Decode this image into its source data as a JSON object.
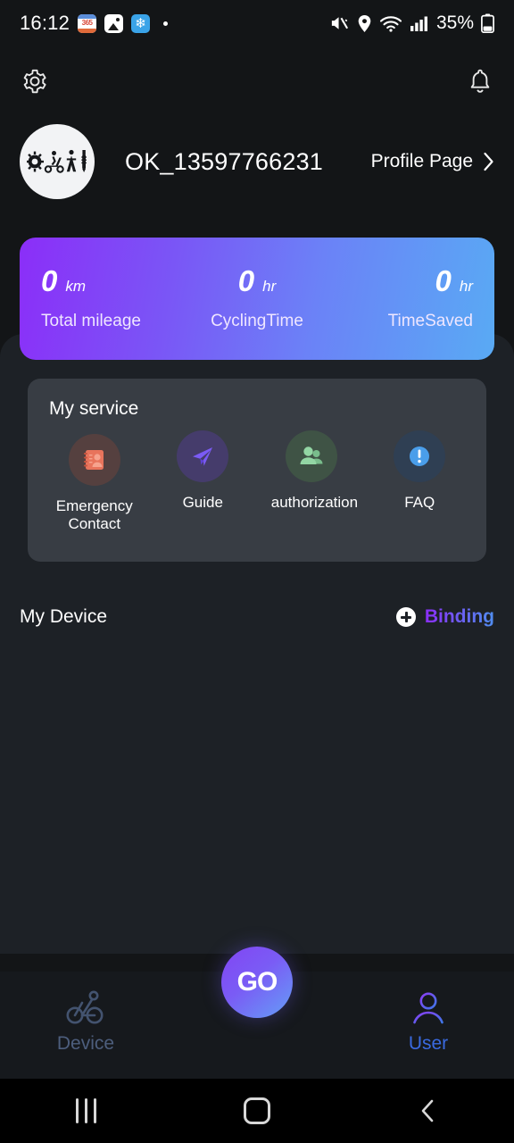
{
  "status_bar": {
    "time": "16:12",
    "app_icons": [
      "calendar-365-icon",
      "photos-icon",
      "snowflake-icon",
      "dot-indicator"
    ],
    "calendar_badge": "365",
    "battery_text": "35%",
    "right_icons": [
      "mute-icon",
      "location-icon",
      "wifi-icon",
      "signal-icon",
      "battery-icon"
    ]
  },
  "topbar": {
    "settings_icon": "gear-icon",
    "notification_icon": "bell-icon"
  },
  "profile": {
    "avatar_icon": "scooter-avatar-icon",
    "username": "OK_13597766231",
    "link_label": "Profile Page",
    "link_chevron": "chevron-right-icon"
  },
  "stats": {
    "items": [
      {
        "value": "0",
        "unit": "km",
        "label": "Total mileage"
      },
      {
        "value": "0",
        "unit": "hr",
        "label": "CyclingTime"
      },
      {
        "value": "0",
        "unit": "hr",
        "label": "TimeSaved"
      }
    ],
    "gradient_start": "#8b2ef8",
    "gradient_end": "#59aaf4"
  },
  "service": {
    "title": "My service",
    "items": [
      {
        "label": "Emergency Contact",
        "icon": "contact-card-icon",
        "circle_color": "#55403f",
        "icon_color": "#e8745c"
      },
      {
        "label": "Guide",
        "icon": "paper-plane-icon",
        "circle_color": "#453c6b",
        "icon_color": "#7b5bf5"
      },
      {
        "label": "authorization",
        "icon": "people-icon",
        "circle_color": "#3f5345",
        "icon_color": "#8ad49a"
      },
      {
        "label": "FAQ",
        "icon": "info-exclamation-icon",
        "circle_color": "#2f3f53",
        "icon_color": "#4a9eea"
      }
    ]
  },
  "device_section": {
    "title": "My Device",
    "binding_label": "Binding",
    "binding_icon": "plus-circle-icon"
  },
  "bottom_nav": {
    "items": [
      {
        "label": "Device",
        "icon": "scooter-icon",
        "active": false
      },
      {
        "label": "GO",
        "icon": "go-button-icon",
        "active": false
      },
      {
        "label": "User",
        "icon": "person-icon",
        "active": true
      }
    ]
  },
  "android_nav": {
    "recents": "recents-icon",
    "home": "home-icon",
    "back": "back-icon"
  }
}
